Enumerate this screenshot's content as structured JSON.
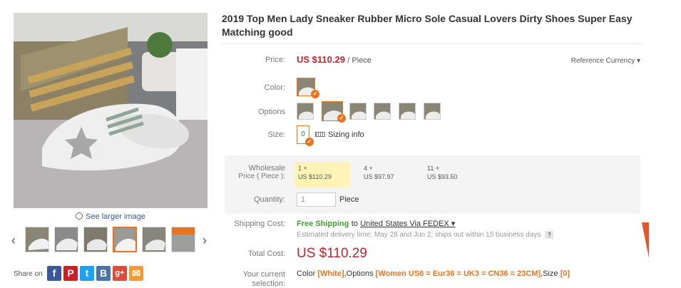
{
  "gallery": {
    "see_larger": "See larger image",
    "share_label": "Share on",
    "share_buttons": [
      {
        "icon": "facebook-icon",
        "glyph": "f",
        "color": "#3b5998"
      },
      {
        "icon": "pinterest-icon",
        "glyph": "P",
        "color": "#cb2027"
      },
      {
        "icon": "twitter-icon",
        "glyph": "t",
        "color": "#1da1f2"
      },
      {
        "icon": "vk-icon",
        "glyph": "B",
        "color": "#4c75a3"
      },
      {
        "icon": "google-plus-icon",
        "glyph": "g+",
        "color": "#dd4b39"
      },
      {
        "icon": "email-icon",
        "glyph": "✉",
        "color": "#f39c34"
      }
    ],
    "thumbnails": 6,
    "active_thumbnail": 3
  },
  "product": {
    "title": "2019 Top Men Lady Sneaker Rubber Micro Sole Casual Lovers Dirty Shoes Super Easy Matching good"
  },
  "price": {
    "label": "Price:",
    "value": "US $110.29",
    "unit": "/ Piece",
    "reference_currency": "Reference Currency ▾"
  },
  "color": {
    "label": "Color:"
  },
  "options": {
    "label": "Options",
    "count": 6,
    "selected": 1
  },
  "size": {
    "label": "Size:",
    "value": "0",
    "sizing_info": "Sizing info"
  },
  "wholesale": {
    "label": "Wholesale",
    "label2": "Price ( Piece ):",
    "tiers": [
      {
        "qty": "1 +",
        "price": "US $110.29"
      },
      {
        "qty": "4 +",
        "price": "US $97.97"
      },
      {
        "qty": "11 +",
        "price": "US $93.50"
      }
    ]
  },
  "quantity": {
    "label": "Quantity:",
    "value": "1",
    "unit": "Piece"
  },
  "shipping": {
    "label": "Shipping Cost:",
    "free": "Free Shipping",
    "to": "to",
    "destination": "United States Via FEDEX ▾",
    "eta": "Estimated delivery time: May 28 and Jun 2, ships out within 15 business days",
    "help": "?"
  },
  "total": {
    "label": "Total Cost:",
    "value": "US $110.29"
  },
  "selection": {
    "label": "Your current",
    "label2": "selection:",
    "color_prefix": "Color",
    "color_value": "[White]",
    "options_prefix": ",Options",
    "options_value": "[Women US6 = Eur36 = UK3 = CN36 = 23CM]",
    "size_prefix": ",Size",
    "size_value": "[0]"
  },
  "colors": {
    "accent": "#e87422",
    "price": "#c0262d",
    "free_shipping": "#3f9f2f"
  }
}
